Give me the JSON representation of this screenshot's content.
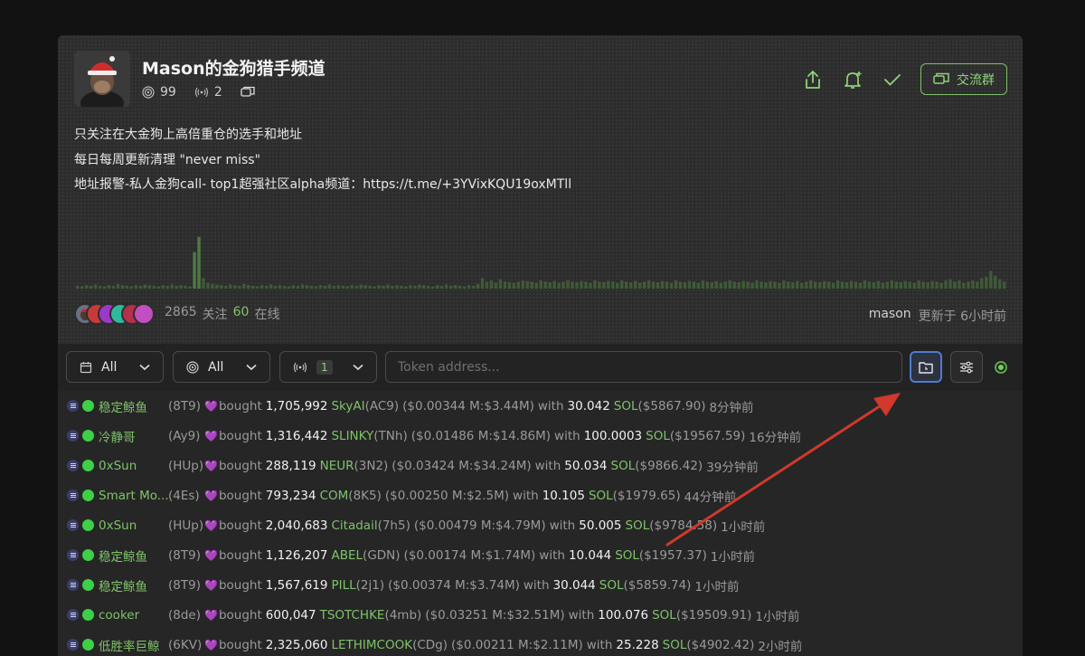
{
  "channel": {
    "title": "Mason的金狗猎手频道",
    "stats": [
      {
        "icon": "target-icon",
        "value": "99"
      },
      {
        "icon": "broadcast-icon",
        "value": "2"
      },
      {
        "icon": "chat-icon",
        "value": ""
      }
    ],
    "group_label": "交流群",
    "description": [
      "只关注在大金狗上高倍重仓的选手和地址",
      "每日每周更新清理 \"never miss\"",
      "地址报警-私人金狗call- top1超强社区alpha频道：https://t.me/+3YVixKQU19oxMTll"
    ],
    "follow_count": "2865",
    "follow_label": "关注",
    "online_count": "60",
    "online_label": "在线",
    "author": "mason",
    "updated_text": "更新于 6小时前",
    "activity_levels": [
      0.05,
      0.04,
      0.06,
      0.05,
      0.07,
      0.05,
      0.04,
      0.06,
      0.05,
      0.08,
      0.06,
      0.05,
      0.04,
      0.06,
      0.05,
      0.07,
      0.06,
      0.05,
      0.04,
      0.06,
      0.05,
      0.07,
      0.05,
      0.06,
      0.05,
      0.04,
      0.62,
      0.88,
      0.18,
      0.1,
      0.08,
      0.07,
      0.06,
      0.05,
      0.07,
      0.06,
      0.05,
      0.08,
      0.06,
      0.05,
      0.04,
      0.06,
      0.05,
      0.07,
      0.05,
      0.06,
      0.05,
      0.04,
      0.06,
      0.05,
      0.07,
      0.06,
      0.05,
      0.04,
      0.06,
      0.05,
      0.07,
      0.05,
      0.06,
      0.05,
      0.04,
      0.06,
      0.05,
      0.07,
      0.06,
      0.05,
      0.04,
      0.06,
      0.05,
      0.07,
      0.05,
      0.06,
      0.05,
      0.04,
      0.06,
      0.05,
      0.07,
      0.06,
      0.05,
      0.04,
      0.06,
      0.05,
      0.07,
      0.05,
      0.06,
      0.05,
      0.04,
      0.06,
      0.05,
      0.08,
      0.18,
      0.12,
      0.14,
      0.1,
      0.16,
      0.12,
      0.11,
      0.1,
      0.12,
      0.14,
      0.13,
      0.12,
      0.1,
      0.14,
      0.12,
      0.11,
      0.13,
      0.1,
      0.12,
      0.14,
      0.12,
      0.11,
      0.13,
      0.12,
      0.1,
      0.14,
      0.12,
      0.11,
      0.13,
      0.12,
      0.1,
      0.14,
      0.12,
      0.11,
      0.13,
      0.1,
      0.12,
      0.14,
      0.12,
      0.11,
      0.13,
      0.12,
      0.1,
      0.14,
      0.12,
      0.11,
      0.13,
      0.12,
      0.1,
      0.14,
      0.12,
      0.11,
      0.13,
      0.1,
      0.12,
      0.14,
      0.12,
      0.11,
      0.13,
      0.12,
      0.1,
      0.14,
      0.12,
      0.11,
      0.13,
      0.12,
      0.1,
      0.14,
      0.12,
      0.11,
      0.13,
      0.1,
      0.12,
      0.14,
      0.12,
      0.11,
      0.13,
      0.12,
      0.1,
      0.14,
      0.12,
      0.11,
      0.13,
      0.12,
      0.1,
      0.14,
      0.12,
      0.11,
      0.13,
      0.1,
      0.12,
      0.14,
      0.12,
      0.11,
      0.13,
      0.12,
      0.1,
      0.14,
      0.12,
      0.11,
      0.13,
      0.12,
      0.1,
      0.14,
      0.16,
      0.12,
      0.14,
      0.1,
      0.12,
      0.14,
      0.12,
      0.18,
      0.2,
      0.3,
      0.22,
      0.16,
      0.12
    ]
  },
  "filters": {
    "date_value": "All",
    "type_value": "All",
    "signal_value": "1",
    "token_placeholder": "Token address..."
  },
  "feed": [
    {
      "name": "稳定鲸鱼",
      "short": "(8T9)",
      "action": "bought",
      "amount": "1,705,992",
      "token": "SkyAI",
      "token_id": "(AC9)",
      "price": "($0.00344 M:$3.44M)",
      "with": "with",
      "sol_amt": "30.042",
      "sol": "SOL",
      "usd": "($5867.90)",
      "time": "8分钟前"
    },
    {
      "name": "冷静哥",
      "short": "(Ay9)",
      "action": "bought",
      "amount": "1,316,442",
      "token": "SLINKY",
      "token_id": "(TNh)",
      "price": "($0.01486 M:$14.86M)",
      "with": "with",
      "sol_amt": "100.0003",
      "sol": "SOL",
      "usd": "($19567.59)",
      "time": "16分钟前"
    },
    {
      "name": "0xSun",
      "short": "(HUp)",
      "action": "bought",
      "amount": "288,119",
      "token": "NEUR",
      "token_id": "(3N2)",
      "price": "($0.03424 M:$34.24M)",
      "with": "with",
      "sol_amt": "50.034",
      "sol": "SOL",
      "usd": "($9866.42)",
      "time": "39分钟前"
    },
    {
      "name": "Smart Mo...",
      "short": "(4Es)",
      "action": "bought",
      "amount": "793,234",
      "token": "COM",
      "token_id": "(8K5)",
      "price": "($0.00250 M:$2.5M)",
      "with": "with",
      "sol_amt": "10.105",
      "sol": "SOL",
      "usd": "($1979.65)",
      "time": "44分钟前"
    },
    {
      "name": "0xSun",
      "short": "(HUp)",
      "action": "bought",
      "amount": "2,040,683",
      "token": "Citadail",
      "token_id": "(7h5)",
      "price": "($0.00479 M:$4.79M)",
      "with": "with",
      "sol_amt": "50.005",
      "sol": "SOL",
      "usd": "($9784.58)",
      "time": "1小时前"
    },
    {
      "name": "稳定鲸鱼",
      "short": "(8T9)",
      "action": "bought",
      "amount": "1,126,207",
      "token": "ABEL",
      "token_id": "(GDN)",
      "price": "($0.00174 M:$1.74M)",
      "with": "with",
      "sol_amt": "10.044",
      "sol": "SOL",
      "usd": "($1957.37)",
      "time": "1小时前"
    },
    {
      "name": "稳定鲸鱼",
      "short": "(8T9)",
      "action": "bought",
      "amount": "1,567,619",
      "token": "PILL",
      "token_id": "(2j1)",
      "price": "($0.00374 M:$3.74M)",
      "with": "with",
      "sol_amt": "30.044",
      "sol": "SOL",
      "usd": "($5859.74)",
      "time": "1小时前"
    },
    {
      "name": "cooker",
      "short": "(8de)",
      "action": "bought",
      "amount": "600,047",
      "token": "TSOTCHKE",
      "token_id": "(4mb)",
      "price": "($0.03251 M:$32.51M)",
      "with": "with",
      "sol_amt": "100.076",
      "sol": "SOL",
      "usd": "($19509.91)",
      "time": "1小时前"
    },
    {
      "name": "低胜率巨鲸",
      "short": "(6KV)",
      "action": "bought",
      "amount": "2,325,060",
      "token": "LETHIMCOOK",
      "token_id": "(CDg)",
      "price": "($0.00211 M:$2.11M)",
      "with": "with",
      "sol_amt": "25.228",
      "sol": "SOL",
      "usd": "($4902.42)",
      "time": "2小时前"
    }
  ],
  "colors": {
    "accent_green": "#7fc36a",
    "arrow_red": "#d0392b",
    "focus_blue": "#4f7bd1"
  }
}
